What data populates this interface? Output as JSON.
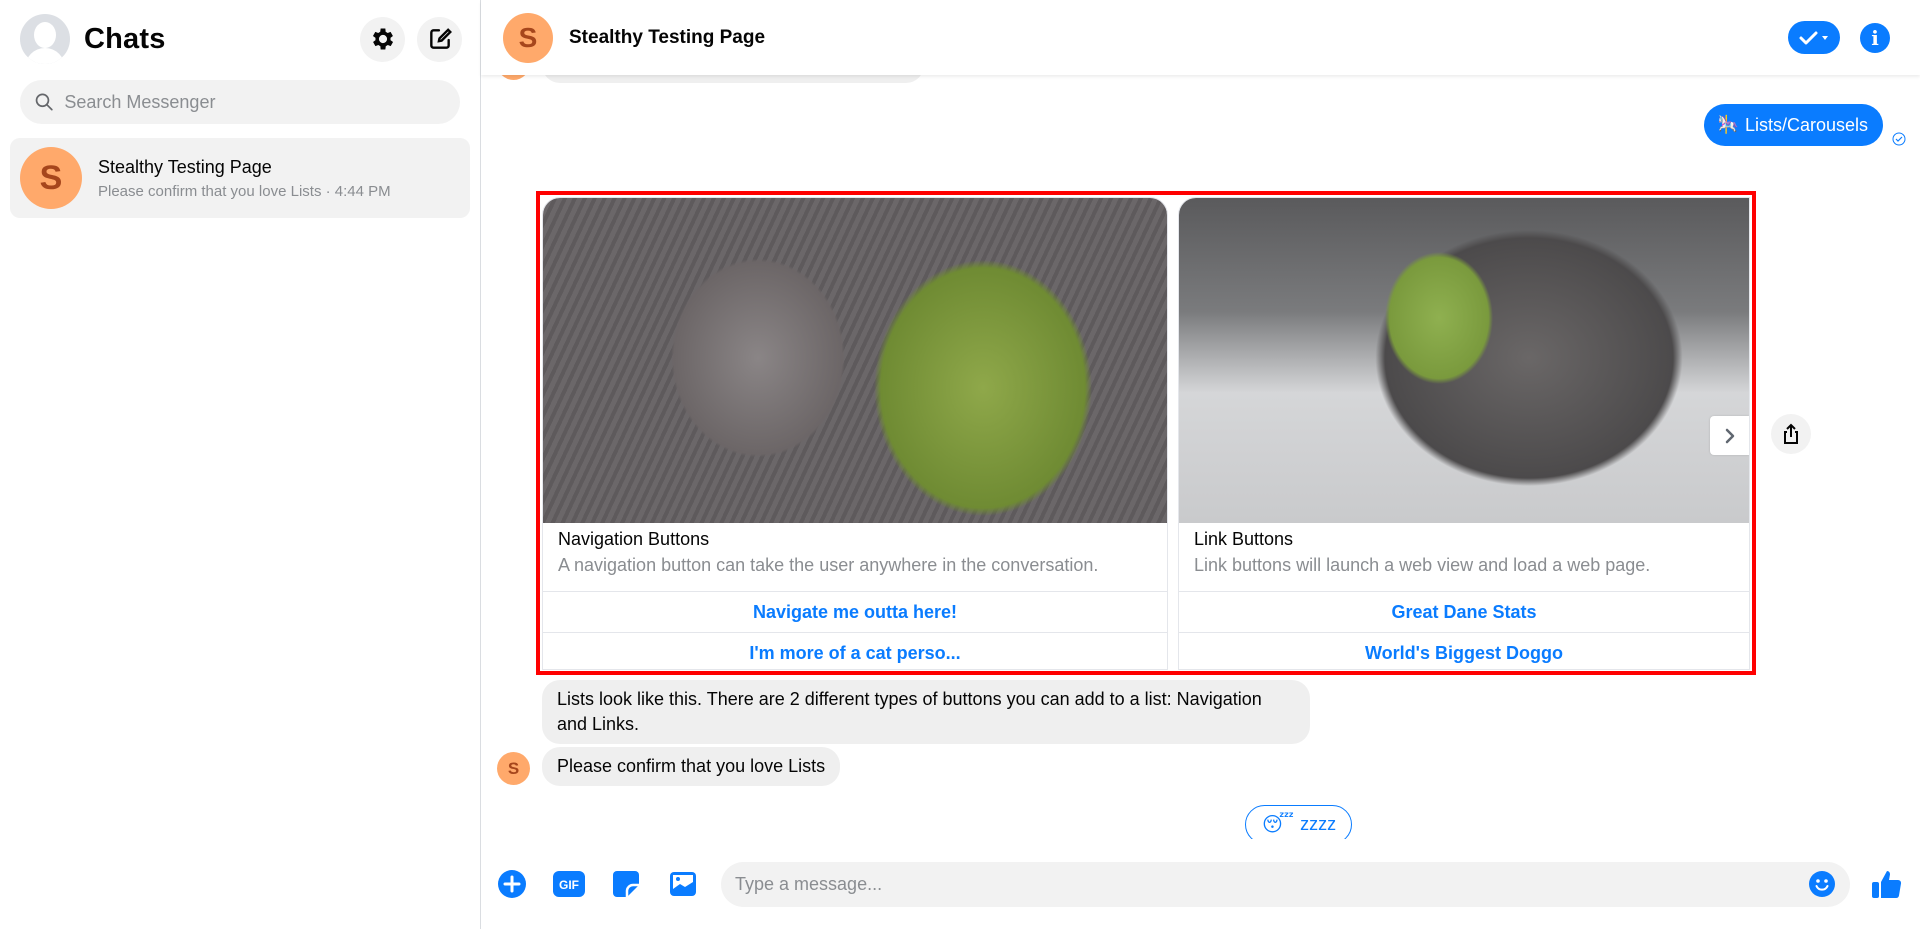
{
  "sidebar": {
    "title": "Chats",
    "settings_icon": "gear-icon",
    "compose_icon": "new-message-icon",
    "search": {
      "placeholder": "Search Messenger",
      "value": ""
    },
    "conversations": [
      {
        "avatar_letter": "S",
        "name": "Stealthy Testing Page",
        "snippet": "Please confirm that you love Lists · 4:44 PM",
        "selected": true
      }
    ]
  },
  "header": {
    "avatar_letter": "S",
    "name": "Stealthy Testing Page",
    "status_icon": "check-dropdown-icon",
    "info_icon": "info-icon"
  },
  "colors": {
    "accent": "#0a7cff",
    "avatar_bg": "#ffa96b",
    "avatar_fg": "#a6461c",
    "bubble_incoming": "#efefef",
    "highlight_frame": "#ff0000"
  },
  "messages": {
    "outgoing": {
      "emoji": "🎠",
      "text": "Lists/Carousels",
      "status": "sent"
    },
    "carousel": {
      "cards": [
        {
          "image": "puppy-with-plush-dragon",
          "title": "Navigation Buttons",
          "subtitle": "A navigation button can take the user anywhere in the conversation.",
          "buttons": [
            "Navigate me outta here!",
            "I'm more of a cat perso..."
          ]
        },
        {
          "image": "great-dane-with-plush-dragon",
          "title": "Link Buttons",
          "subtitle": "Link buttons will launch a web view and load a web page.",
          "buttons": [
            "Great Dane Stats",
            "World's Biggest Doggo"
          ]
        }
      ],
      "next_icon": "chevron-right-icon",
      "share_icon": "share-icon"
    },
    "incoming": [
      {
        "text": "Lists look like this. There are 2 different types of buttons you can add to a list: Navigation and Links."
      },
      {
        "text": "Please confirm that you love Lists",
        "avatar_letter": "S"
      }
    ],
    "quick_replies": [
      {
        "emoji": "😴",
        "label": "zzzz"
      }
    ]
  },
  "composer": {
    "placeholder": "Type a message...",
    "value": "",
    "icons": [
      "plus-icon",
      "gif-icon",
      "sticker-icon",
      "image-icon",
      "emoji-icon",
      "thumbs-up-icon"
    ],
    "gif_label": "GIF"
  }
}
